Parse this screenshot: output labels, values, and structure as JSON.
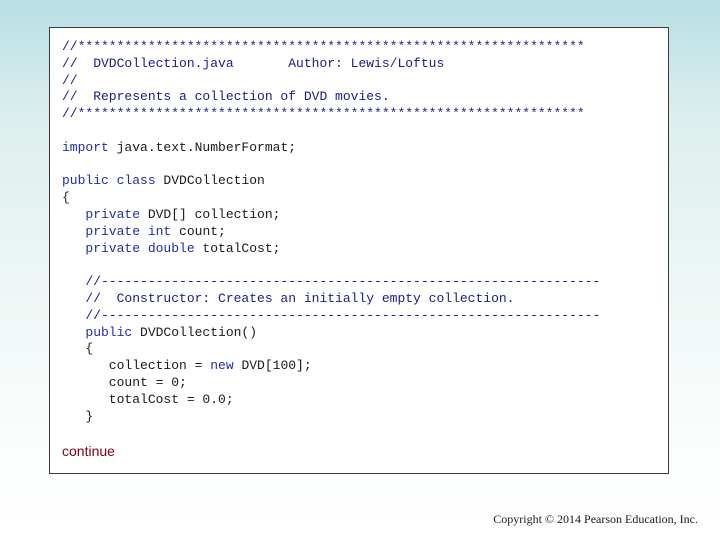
{
  "slide": {
    "code_lines": [
      [
        [
          "cmt",
          "//*****************************************************************"
        ]
      ],
      [
        [
          "cmt",
          "//  DVDCollection.java       Author: Lewis/Loftus"
        ]
      ],
      [
        [
          "cmt",
          "//"
        ]
      ],
      [
        [
          "cmt",
          "//  Represents a collection of DVD movies."
        ]
      ],
      [
        [
          "cmt",
          "//*****************************************************************"
        ]
      ],
      [],
      [
        [
          "kw",
          "import"
        ],
        [
          "txt",
          " java.text.NumberFormat;"
        ]
      ],
      [],
      [
        [
          "kw",
          "public class"
        ],
        [
          "txt",
          " DVDCollection"
        ]
      ],
      [
        [
          "txt",
          "{"
        ]
      ],
      [
        [
          "txt",
          "   "
        ],
        [
          "kw",
          "private"
        ],
        [
          "txt",
          " DVD[] collection;"
        ]
      ],
      [
        [
          "txt",
          "   "
        ],
        [
          "kw",
          "private int"
        ],
        [
          "txt",
          " count;"
        ]
      ],
      [
        [
          "txt",
          "   "
        ],
        [
          "kw",
          "private double"
        ],
        [
          "txt",
          " totalCost;"
        ]
      ],
      [],
      [
        [
          "cmt",
          "   //----------------------------------------------------------------"
        ]
      ],
      [
        [
          "cmt",
          "   //  Constructor: Creates an initially empty collection."
        ]
      ],
      [
        [
          "cmt",
          "   //----------------------------------------------------------------"
        ]
      ],
      [
        [
          "kw",
          "   public"
        ],
        [
          "txt",
          " DVDCollection()"
        ]
      ],
      [
        [
          "txt",
          "   {"
        ]
      ],
      [
        [
          "txt",
          "      collection = "
        ],
        [
          "kw",
          "new"
        ],
        [
          "txt",
          " DVD[100];"
        ]
      ],
      [
        [
          "txt",
          "      count = 0;"
        ]
      ],
      [
        [
          "txt",
          "      totalCost = 0.0;"
        ]
      ],
      [
        [
          "txt",
          "   }"
        ]
      ]
    ],
    "continue_label": "continue",
    "copyright": "Copyright © 2014 Pearson Education, Inc."
  }
}
